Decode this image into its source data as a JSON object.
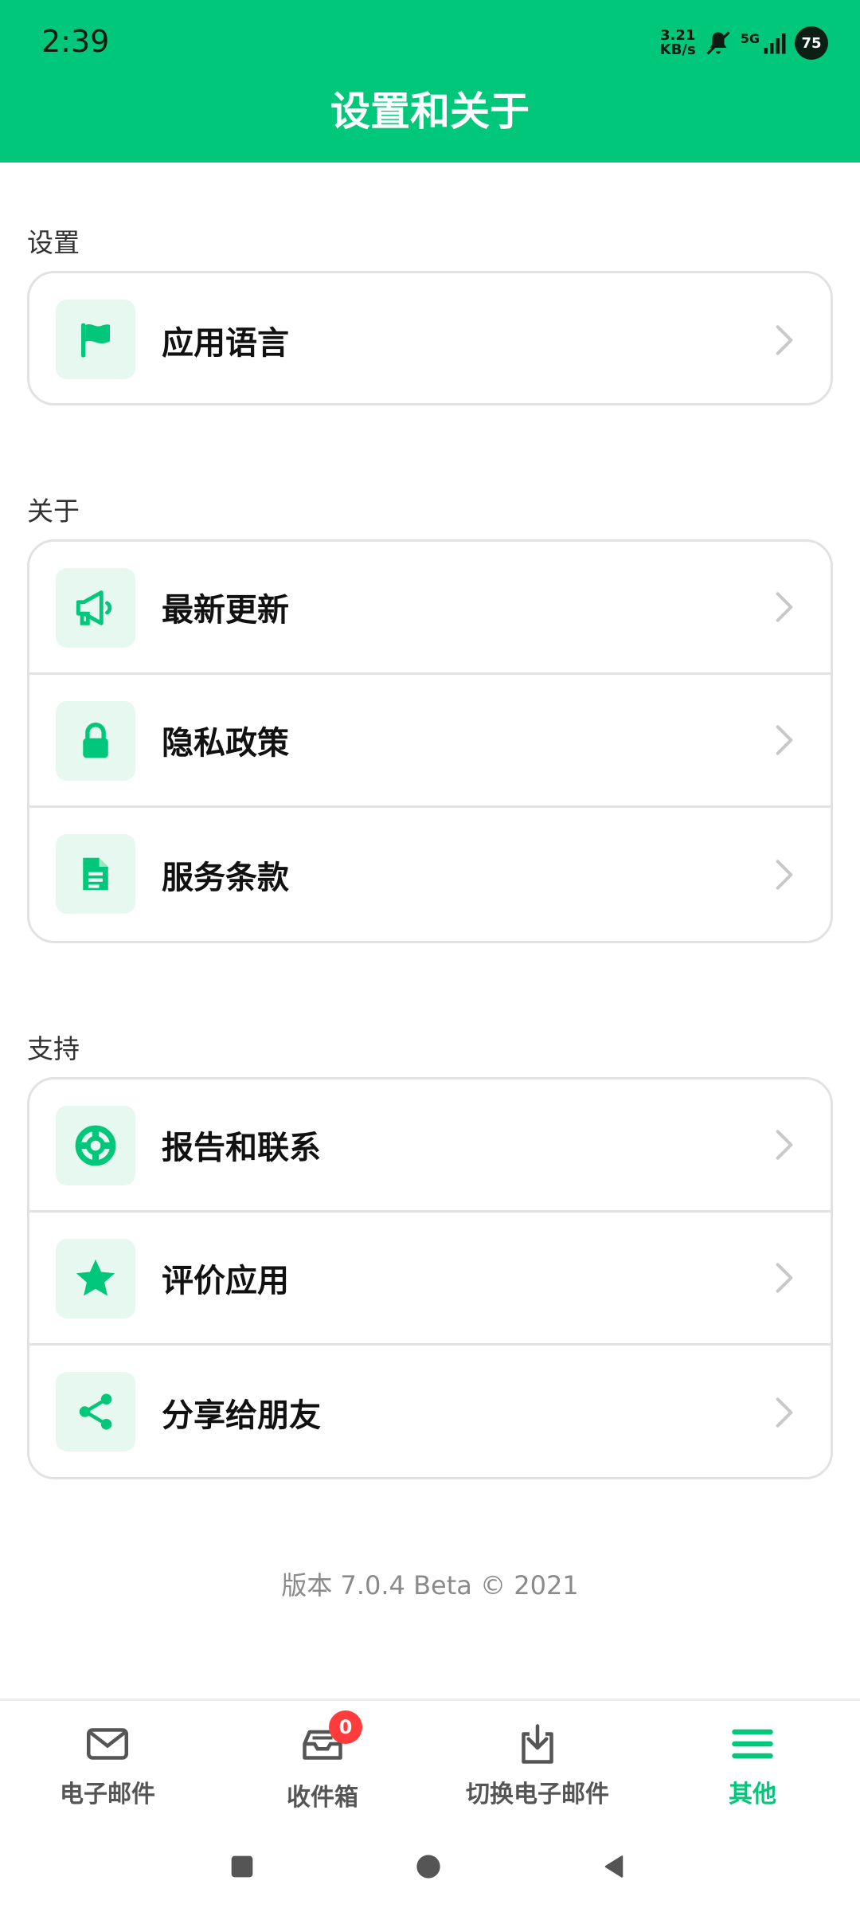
{
  "status": {
    "time": "2:39",
    "net_speed_value": "3.21",
    "net_speed_unit": "KB/s",
    "network": "5G",
    "battery": "75"
  },
  "header": {
    "title": "设置和关于"
  },
  "sections": {
    "settings": {
      "label": "设置",
      "items": [
        {
          "label": "应用语言",
          "icon": "flag-icon"
        }
      ]
    },
    "about": {
      "label": "关于",
      "items": [
        {
          "label": "最新更新",
          "icon": "megaphone-icon"
        },
        {
          "label": "隐私政策",
          "icon": "lock-icon"
        },
        {
          "label": "服务条款",
          "icon": "document-icon"
        }
      ]
    },
    "support": {
      "label": "支持",
      "items": [
        {
          "label": "报告和联系",
          "icon": "lifebuoy-icon"
        },
        {
          "label": "评价应用",
          "icon": "star-icon"
        },
        {
          "label": "分享给朋友",
          "icon": "share-icon"
        }
      ]
    }
  },
  "footer": {
    "version": "版本 7.0.4 Beta © 2021"
  },
  "bottom_nav": {
    "items": [
      {
        "label": "电子邮件",
        "icon": "mail-icon"
      },
      {
        "label": "收件箱",
        "icon": "inbox-icon",
        "badge": "0"
      },
      {
        "label": "切换电子邮件",
        "icon": "download-icon"
      },
      {
        "label": "其他",
        "icon": "menu-icon",
        "active": true
      }
    ]
  },
  "colors": {
    "brand": "#00c77a",
    "icon_bg": "#e6f8ef",
    "badge": "#ff3b3b"
  }
}
